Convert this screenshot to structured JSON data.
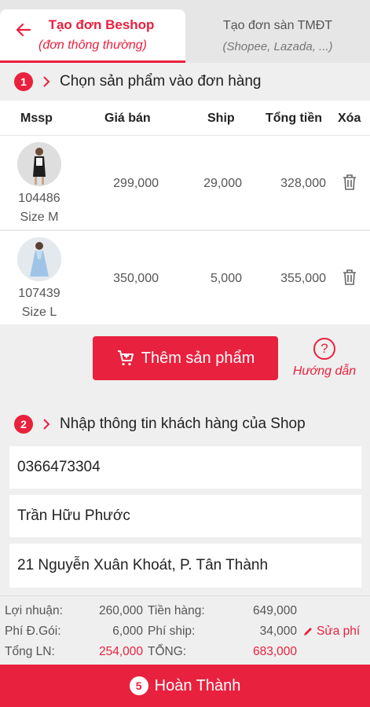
{
  "tabs": {
    "active": {
      "title": "Tạo đơn Beshop",
      "subtitle": "(đơn thông thường)"
    },
    "other": {
      "title": "Tạo đơn sàn TMĐT",
      "subtitle": "(Shopee, Lazada, ...)"
    }
  },
  "step1": {
    "num": "1",
    "title": "Chọn sản phẩm vào đơn hàng"
  },
  "table": {
    "headers": {
      "sku": "Mssp",
      "price": "Giá bán",
      "ship": "Ship",
      "total": "Tổng tiền",
      "delete": "Xóa"
    },
    "rows": [
      {
        "code": "104486",
        "size": "Size M",
        "price": "299,000",
        "ship": "29,000",
        "total": "328,000"
      },
      {
        "code": "107439",
        "size": "Size L",
        "price": "350,000",
        "ship": "5,000",
        "total": "355,000"
      }
    ]
  },
  "add_button": {
    "label": "Thêm sản phẩm"
  },
  "help": {
    "icon": "?",
    "label": "Hướng dẫn"
  },
  "step2": {
    "num": "2",
    "title": "Nhập thông tin khách hàng của Shop"
  },
  "customer": {
    "phone": "0366473304",
    "name": "Trần Hữu Phước",
    "address": "21 Nguyễn Xuân Khoát, P. Tân Thành"
  },
  "summary": {
    "profit_label": "Lợi nhuận:",
    "profit": "260,000",
    "pack_label": "Phí Đ.Gói:",
    "pack": "6,000",
    "total_profit_label": "Tổng LN:",
    "total_profit": "254,000",
    "goods_label": "Tiền hàng:",
    "goods": "649,000",
    "ship_label": "Phí ship:",
    "ship": "34,000",
    "total_label": "TỔNG:",
    "total": "683,000",
    "edit_fee_label": "Sửa phí"
  },
  "finish": {
    "num": "5",
    "label": "Hoàn Thành"
  },
  "colors": {
    "accent": "#e8213e",
    "background": "#efefef"
  }
}
